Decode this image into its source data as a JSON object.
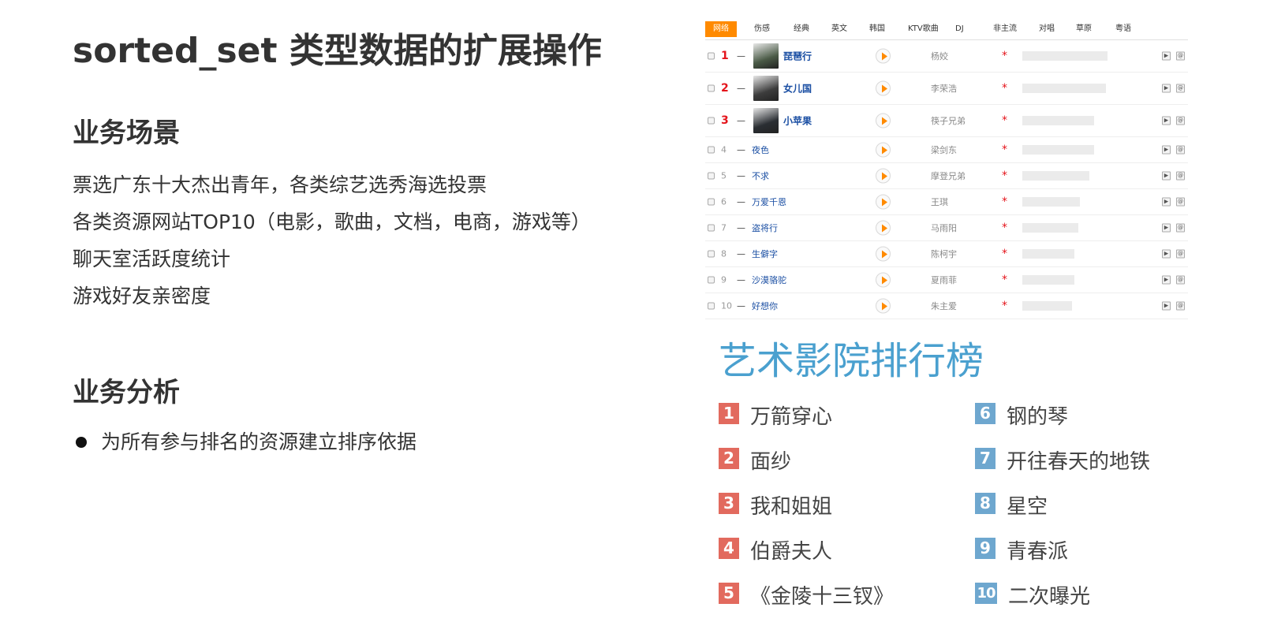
{
  "title": "sorted_set 类型数据的扩展操作",
  "scene": {
    "heading": "业务场景",
    "items": [
      "票选广东十大杰出青年，各类综艺选秀海选投票",
      "各类资源网站TOP10（电影，歌曲，文档，电商，游戏等）",
      "聊天室活跃度统计",
      "游戏好友亲密度"
    ]
  },
  "analysis": {
    "heading": "业务分析",
    "items": [
      "为所有参与排名的资源建立排序依据"
    ]
  },
  "music_chart": {
    "tabs": [
      "网络",
      "伤感",
      "经典",
      "英文",
      "韩国",
      "KTV歌曲",
      "DJ",
      "非主流",
      "对唱",
      "草原",
      "粤语"
    ],
    "active_tab": "网络",
    "rows": [
      {
        "rank": "1",
        "trend": "—",
        "song": "琵琶行",
        "artist": "杨姣",
        "star": "*",
        "popularity": 1.0
      },
      {
        "rank": "2",
        "trend": "—",
        "song": "女儿国",
        "artist": "李荣浩",
        "star": "*",
        "popularity": 0.98
      },
      {
        "rank": "3",
        "trend": "—",
        "song": "小苹果",
        "artist": "筷子兄弟",
        "star": "*",
        "popularity": 0.84
      },
      {
        "rank": "4",
        "trend": "—",
        "song": "夜色",
        "artist": "梁剑东",
        "star": "*",
        "popularity": 0.84
      },
      {
        "rank": "5",
        "trend": "—",
        "song": "不求",
        "artist": "摩登兄弟",
        "star": "*",
        "popularity": 0.79
      },
      {
        "rank": "6",
        "trend": "—",
        "song": "万爱千恩",
        "artist": "王琪",
        "star": "*",
        "popularity": 0.68
      },
      {
        "rank": "7",
        "trend": "—",
        "song": "盗将行",
        "artist": "马雨阳",
        "star": "*",
        "popularity": 0.66
      },
      {
        "rank": "8",
        "trend": "—",
        "song": "生僻字",
        "artist": "陈柯宇",
        "star": "*",
        "popularity": 0.61
      },
      {
        "rank": "9",
        "trend": "—",
        "song": "沙漠骆驼",
        "artist": "夏雨菲",
        "star": "*",
        "popularity": 0.61
      },
      {
        "rank": "10",
        "trend": "—",
        "song": "好想你",
        "artist": "朱主爱",
        "star": "*",
        "popularity": 0.58
      }
    ]
  },
  "cinema": {
    "title": "艺术影院排行榜",
    "left": [
      {
        "num": "1",
        "name": "万箭穿心"
      },
      {
        "num": "2",
        "name": "面纱"
      },
      {
        "num": "3",
        "name": "我和姐姐"
      },
      {
        "num": "4",
        "name": "伯爵夫人"
      },
      {
        "num": "5",
        "name": "《金陵十三钗》"
      }
    ],
    "right": [
      {
        "num": "6",
        "name": "钢的琴"
      },
      {
        "num": "7",
        "name": "开往春天的地铁"
      },
      {
        "num": "8",
        "name": "星空"
      },
      {
        "num": "9",
        "name": "青春派"
      },
      {
        "num": "10",
        "name": "二次曝光"
      }
    ]
  },
  "colors": {
    "accent_orange": "#ff8a00",
    "rank_red": "#e4141b",
    "song_blue": "#1b4fa3",
    "cinema_red": "#e26a5e",
    "cinema_blue": "#6ea7cf",
    "cinema_title": "#4aa0cf"
  }
}
